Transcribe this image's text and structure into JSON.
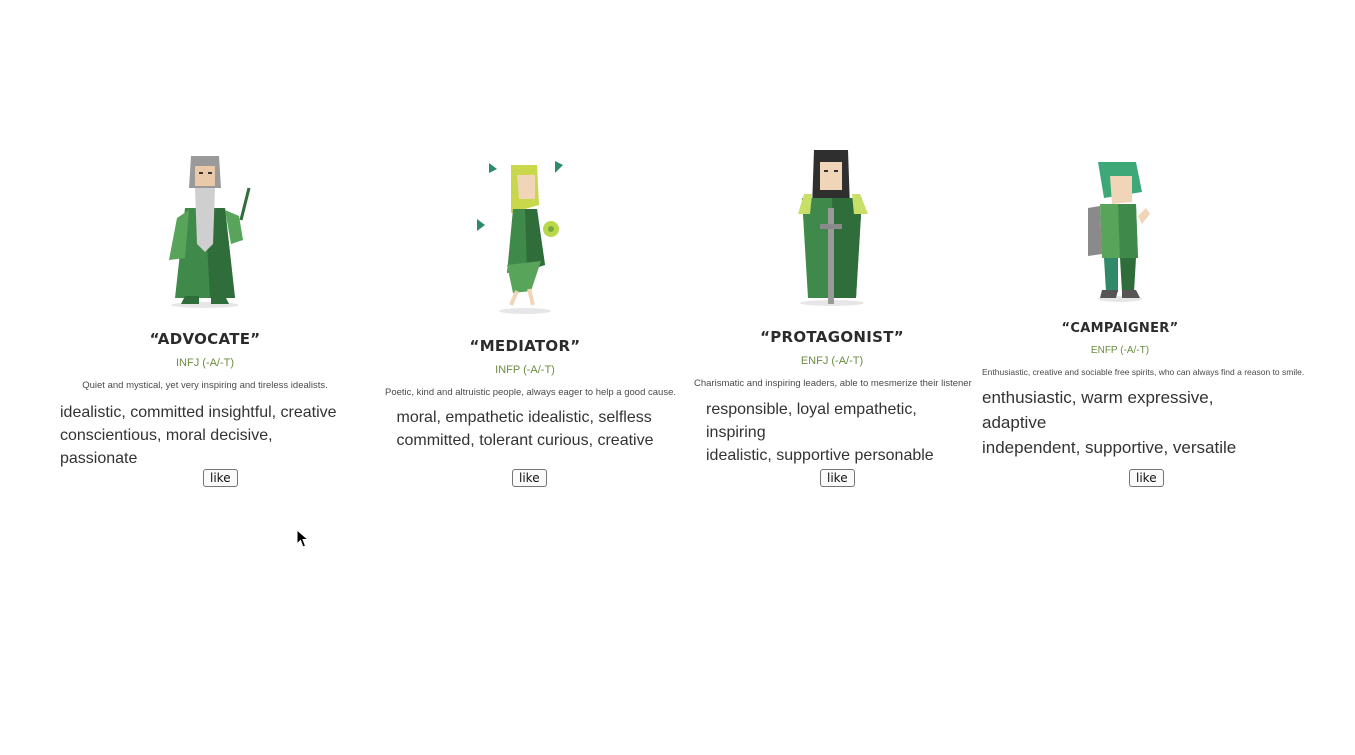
{
  "cards": [
    {
      "title": "“ADVOCATE”",
      "code": "INFJ (-A/-T)",
      "description": "Quiet and mystical, yet very inspiring and tireless idealists.",
      "traits_line1": "idealistic, committed insightful, creative",
      "traits_line2": "conscientious, moral decisive, passionate",
      "like_label": "like",
      "icon": "advocate-illustration"
    },
    {
      "title": "“MEDIATOR”",
      "code": "INFP (-A/-T)",
      "description": "Poetic, kind and altruistic people, always eager to help a good cause.",
      "traits_line1": "moral, empathetic idealistic, selfless",
      "traits_line2": "committed, tolerant curious, creative",
      "like_label": "like",
      "icon": "mediator-illustration"
    },
    {
      "title": "“PROTAGONIST”",
      "code": "ENFJ (-A/-T)",
      "description": "Charismatic and inspiring leaders, able to mesmerize their listener",
      "traits_line1": "responsible, loyal empathetic, inspiring",
      "traits_line2": "idealistic, supportive personable",
      "like_label": "like",
      "icon": "protagonist-illustration"
    },
    {
      "title": "“CAMPAIGNER”",
      "code": "ENFP (-A/-T)",
      "description": "Enthusiastic, creative and sociable free spirits, who can always find a reason to smile.",
      "traits_line1": "enthusiastic, warm expressive, adaptive",
      "traits_line2": "independent, supportive, versatile",
      "like_label": "like",
      "icon": "campaigner-illustration"
    }
  ],
  "colors": {
    "accent_green": "#6b8d3f",
    "robe_green": "#3f8a4a",
    "light_green": "#7fc46b"
  },
  "cursor_icon": "mouse-pointer-icon"
}
